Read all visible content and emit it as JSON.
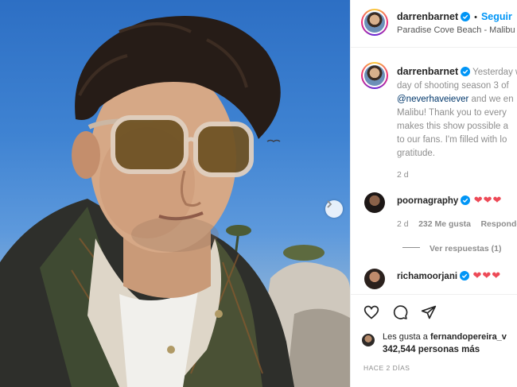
{
  "post": {
    "image_alt": "Selfie of man with sunglasses on a beach",
    "carousel_next_icon": "chevron-right-icon"
  },
  "header": {
    "username": "darrenbarnet",
    "separator": "•",
    "follow_label": "Seguir",
    "location": "Paradise Cove Beach - Malibu"
  },
  "caption": {
    "username": "darrenbarnet",
    "lines": [
      "Yesterday was the last",
      "day of shooting season 3 of",
      "@neverhaveiever",
      "Malibu! Thank you to every",
      "makes this show possible a",
      "to our fans. I'm filled with lo",
      "gratitude."
    ],
    "mention": "@neverhaveiever",
    "mention_rest": "and we en",
    "age": "2 d"
  },
  "comments": [
    {
      "username": "poornagraphy",
      "text": "❤❤❤",
      "age": "2 d",
      "likes": "232 Me gusta",
      "reply": "Responder",
      "view_replies": "Ver respuestas (1)"
    },
    {
      "username": "richamoorjani",
      "text": "❤❤❤"
    }
  ],
  "actions": {
    "like_icon": "heart-icon",
    "comment_icon": "comment-icon",
    "share_icon": "send-icon"
  },
  "likes": {
    "prefix": "Les gusta a ",
    "liker": "fernandopereira_v",
    "others": "342,544 personas más"
  },
  "timestamp": "Hace 2 días",
  "colors": {
    "accent": "#0095f6",
    "heart": "#ed4956",
    "muted": "#8e8e8e",
    "mention": "#00376b"
  }
}
